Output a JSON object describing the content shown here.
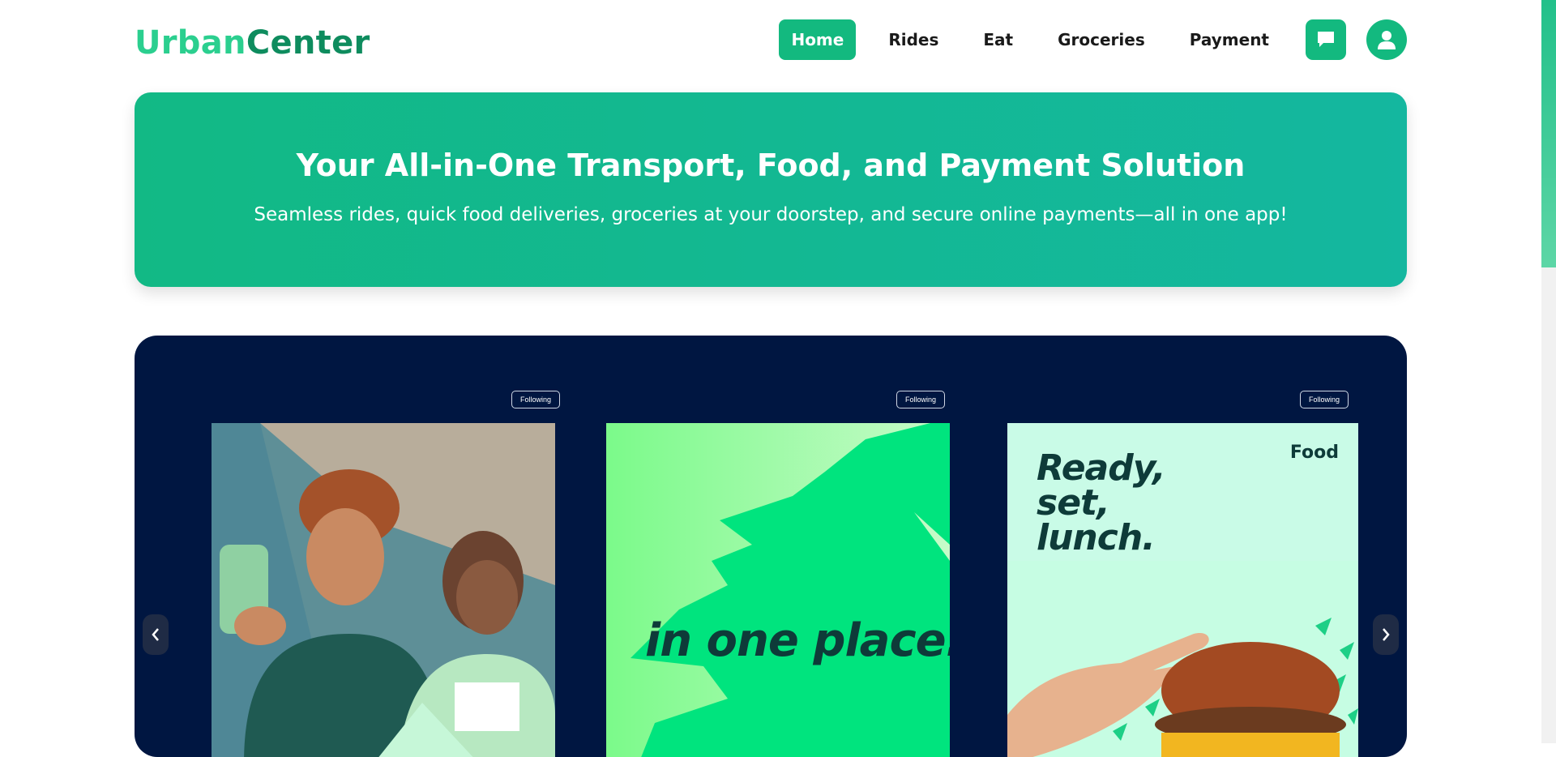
{
  "header": {
    "logo_part1": "Urban",
    "logo_part2": "Center",
    "nav": [
      {
        "label": "Home",
        "active": true
      },
      {
        "label": "Rides",
        "active": false
      },
      {
        "label": "Eat",
        "active": false
      },
      {
        "label": "Groceries",
        "active": false
      },
      {
        "label": "Payment",
        "active": false
      }
    ],
    "chat_icon": "chat-bubble-icon",
    "profile_icon": "user-icon"
  },
  "hero": {
    "title": "Your All-in-One Transport, Food, and Payment Solution",
    "subtitle": "Seamless rides, quick food deliveries, groceries at your doorstep, and secure online payments—all in one app!"
  },
  "carousel": {
    "follow_label": "Following",
    "cards": [
      {
        "image": "friends-with-phone-photo"
      },
      {
        "text": "in one place."
      },
      {
        "heading": [
          "Ready,",
          "set,",
          "lunch."
        ],
        "tag": "Food",
        "image": "hand-reaching-burger-photo"
      }
    ],
    "prev_icon": "chevron-left-icon",
    "next_icon": "chevron-right-icon"
  },
  "colors": {
    "brand_green": "#13b97f",
    "logo_light": "#2bcf8f",
    "logo_dark": "#0e8c5e",
    "carousel_bg": "#001641"
  }
}
